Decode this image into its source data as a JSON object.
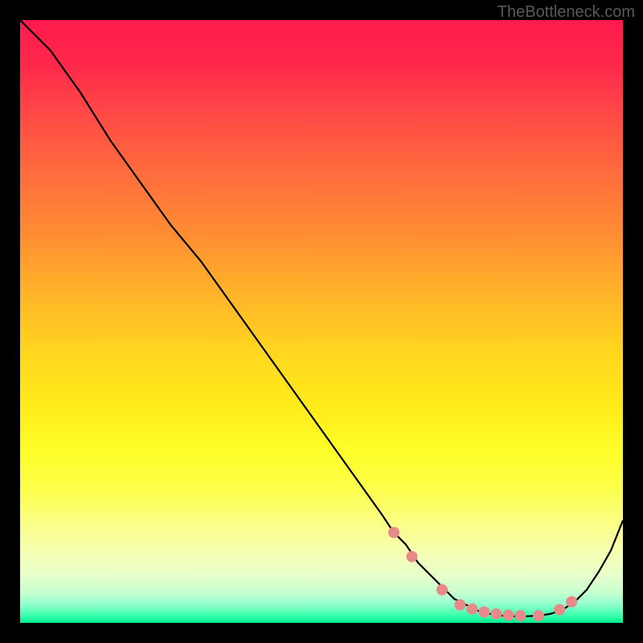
{
  "watermark": "TheBottleneck.com",
  "chart_data": {
    "type": "line",
    "title": "",
    "xlabel": "",
    "ylabel": "",
    "xlim": [
      0,
      100
    ],
    "ylim": [
      0,
      100
    ],
    "series": [
      {
        "name": "curve",
        "color": "#000000",
        "x": [
          0,
          5,
          10,
          15,
          20,
          25,
          30,
          35,
          40,
          45,
          50,
          55,
          60,
          62,
          64,
          66,
          68,
          70,
          72,
          74,
          76,
          78,
          80,
          82,
          84,
          86,
          88,
          90,
          92,
          94,
          96,
          98,
          100
        ],
        "values": [
          100,
          95,
          88,
          80,
          73,
          66,
          60,
          53,
          46,
          39,
          32,
          25,
          18,
          15,
          13,
          10,
          8,
          6,
          4,
          3,
          2,
          1.5,
          1.2,
          1.1,
          1.1,
          1.2,
          1.5,
          2.2,
          3.5,
          5.5,
          8.5,
          12,
          17
        ]
      }
    ],
    "markers": {
      "name": "highlight-dots",
      "color": "#e88a8a",
      "radius": 7,
      "x": [
        62,
        65,
        70,
        73,
        75,
        77,
        79,
        81,
        83,
        86,
        89.5,
        91.5
      ],
      "values": [
        15,
        11,
        5.5,
        3,
        2.3,
        1.8,
        1.5,
        1.3,
        1.2,
        1.2,
        2.2,
        3.5
      ]
    },
    "gradient_stops": [
      {
        "pos": 0.0,
        "color": "#ff1a4d"
      },
      {
        "pos": 0.15,
        "color": "#ff4747"
      },
      {
        "pos": 0.35,
        "color": "#ff8b33"
      },
      {
        "pos": 0.55,
        "color": "#ffd61f"
      },
      {
        "pos": 0.72,
        "color": "#feff2a"
      },
      {
        "pos": 0.88,
        "color": "#f6ffb0"
      },
      {
        "pos": 0.97,
        "color": "#8effcc"
      },
      {
        "pos": 1.0,
        "color": "#00e889"
      }
    ]
  }
}
